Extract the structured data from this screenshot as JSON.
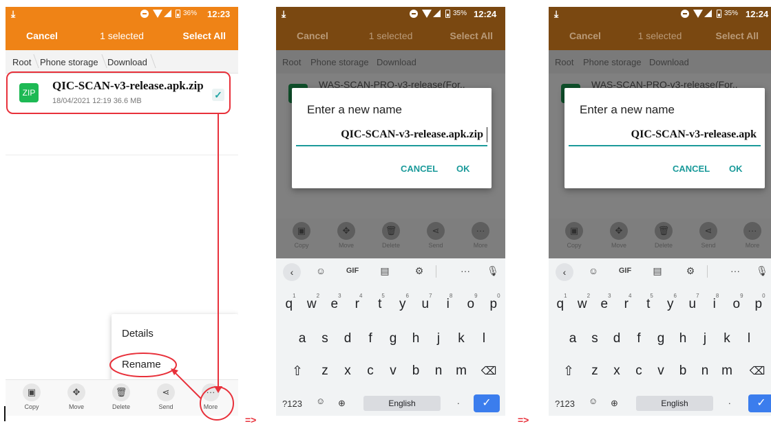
{
  "status_left": {
    "time": "12:23",
    "battery": "36%"
  },
  "status_mid": {
    "time": "12:24",
    "battery": "35%"
  },
  "status_right": {
    "time": "12:24",
    "battery": "35%"
  },
  "actionbar": {
    "cancel": "Cancel",
    "selected": "1 selected",
    "select_all": "Select All"
  },
  "breadcrumb": {
    "root": "Root",
    "storage": "Phone storage",
    "folder": "Download"
  },
  "file": {
    "name": "QIC-SCAN-v3-release.apk.zip",
    "meta": "18/04/2021 12:19  36.6 MB",
    "icon_label": "ZIP"
  },
  "background_file": {
    "name": "WAS-SCAN-PRO-v3-release(For.."
  },
  "context_menu": {
    "details": "Details",
    "rename": "Rename"
  },
  "toolbar": {
    "copy": "Copy",
    "move": "Move",
    "delete": "Delete",
    "send": "Send",
    "more": "More"
  },
  "dialog_mid": {
    "title": "Enter a new name",
    "value": "QIC-SCAN-v3-release.apk.zip",
    "cancel": "CANCEL",
    "ok": "OK"
  },
  "dialog_right": {
    "title": "Enter a new name",
    "value": "QIC-SCAN-v3-release.apk",
    "cancel": "CANCEL",
    "ok": "OK"
  },
  "keyboard": {
    "gif": "GIF",
    "row1": [
      "q",
      "w",
      "e",
      "r",
      "t",
      "y",
      "u",
      "i",
      "o",
      "p"
    ],
    "row1_hints": [
      "1",
      "2",
      "3",
      "4",
      "5",
      "6",
      "7",
      "8",
      "9",
      "0"
    ],
    "row2": [
      "a",
      "s",
      "d",
      "f",
      "g",
      "h",
      "j",
      "k",
      "l"
    ],
    "row3": [
      "z",
      "x",
      "c",
      "v",
      "b",
      "n",
      "m"
    ],
    "symbols": "?123",
    "space": "English",
    "period": "."
  },
  "annotations": {
    "arrow1": "=>",
    "arrow2": "=>"
  },
  "colors": {
    "orange_bar": "#ef8316",
    "highlight_red": "#e8303a",
    "teal_accent": "#1a9a9a",
    "zip_green": "#1db954",
    "enter_blue": "#3b7ded"
  }
}
